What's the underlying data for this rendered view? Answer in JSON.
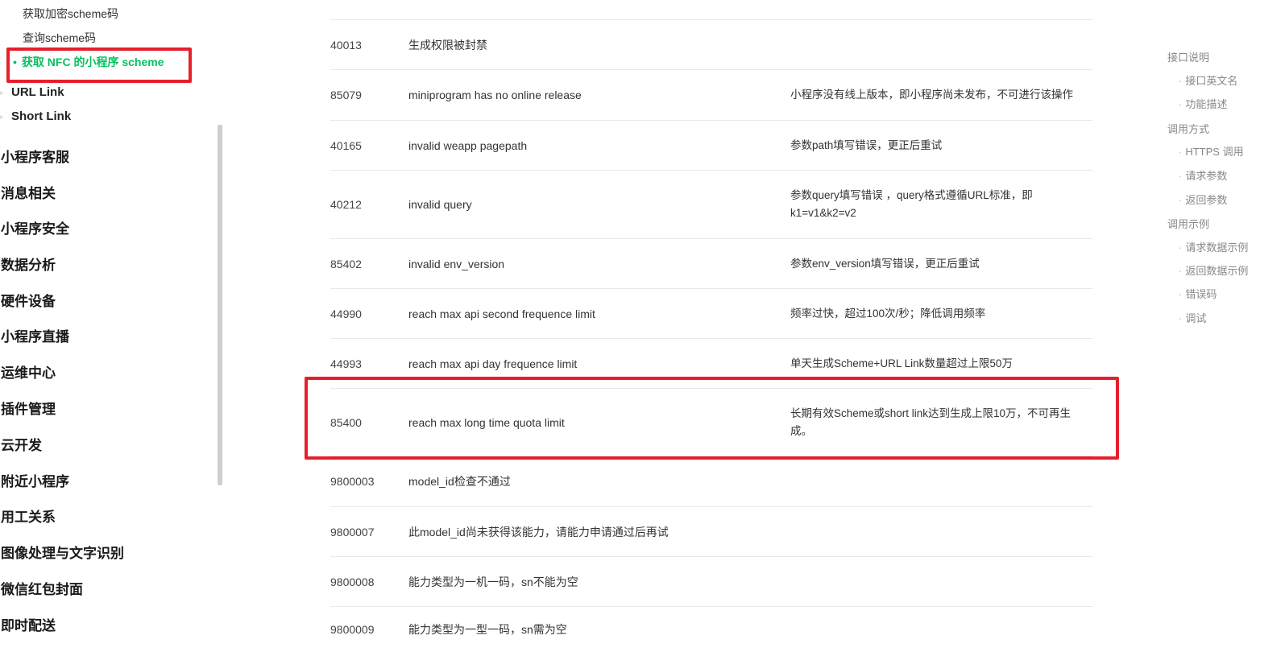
{
  "sidebar": {
    "sub_items": [
      "获取加密scheme码",
      "查询scheme码"
    ],
    "active_item": "获取 NFC 的小程序 scheme",
    "groups": [
      "URL Link",
      "Short Link"
    ],
    "categories": [
      "小程序客服",
      "消息相关",
      "小程序安全",
      "数据分析",
      "硬件设备",
      "小程序直播",
      "运维中心",
      "插件管理",
      "云开发",
      "附近小程序",
      "用工关系",
      "图像处理与文字识别",
      "微信红包封面",
      "即时配送"
    ]
  },
  "error_table": {
    "rows": [
      {
        "code": "40013",
        "message": "生成权限被封禁",
        "description": ""
      },
      {
        "code": "85079",
        "message": "miniprogram has no online release",
        "description": "小程序没有线上版本，即小程序尚未发布，不可进行该操作"
      },
      {
        "code": "40165",
        "message": "invalid weapp pagepath",
        "description": "参数path填写错误，更正后重试"
      },
      {
        "code": "40212",
        "message": "invalid query",
        "description": "参数query填写错误 ，query格式遵循URL标准，即k1=v1&k2=v2"
      },
      {
        "code": "85402",
        "message": "invalid env_version",
        "description": "参数env_version填写错误，更正后重试"
      },
      {
        "code": "44990",
        "message": "reach max api second frequence limit",
        "description": "频率过快，超过100次/秒；降低调用频率"
      },
      {
        "code": "44993",
        "message": "reach max api day frequence limit",
        "description": "单天生成Scheme+URL Link数量超过上限50万"
      },
      {
        "code": "85400",
        "message": "reach max long time quota limit",
        "description": "长期有效Scheme或short link达到生成上限10万，不可再生成。"
      },
      {
        "code": "9800003",
        "message": "model_id检查不通过",
        "description": ""
      },
      {
        "code": "9800007",
        "message": "此model_id尚未获得该能力，请能力申请通过后再试",
        "description": ""
      },
      {
        "code": "9800008",
        "message": "能力类型为一机一码，sn不能为空",
        "description": ""
      },
      {
        "code": "9800009",
        "message": "能力类型为一型一码，sn需为空",
        "description": ""
      }
    ]
  },
  "toc": {
    "items": [
      {
        "label": "接口说明",
        "level": 1
      },
      {
        "label": "接口英文名",
        "level": 2
      },
      {
        "label": "功能描述",
        "level": 2
      },
      {
        "label": "调用方式",
        "level": 1
      },
      {
        "label": "HTTPS 调用",
        "level": 2
      },
      {
        "label": "请求参数",
        "level": 2
      },
      {
        "label": "返回参数",
        "level": 2
      },
      {
        "label": "调用示例",
        "level": 1
      },
      {
        "label": "请求数据示例",
        "level": 2
      },
      {
        "label": "返回数据示例",
        "level": 2
      },
      {
        "label": "错误码",
        "level": 2
      },
      {
        "label": "调试",
        "level": 2
      }
    ]
  },
  "colors": {
    "accent_green": "#07c160",
    "highlight_red": "#e5202b"
  }
}
